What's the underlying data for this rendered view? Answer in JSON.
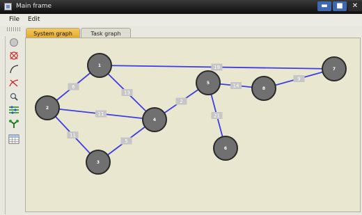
{
  "window": {
    "title": "Main frame",
    "min_label": "▬",
    "max_label": "■",
    "close_label": "✕"
  },
  "menu": {
    "items": [
      "File",
      "Edit"
    ]
  },
  "tabs": [
    {
      "label": "System graph",
      "active": true
    },
    {
      "label": "Task graph",
      "active": false
    }
  ],
  "toolbar": {
    "tools": [
      {
        "name": "add-node-icon"
      },
      {
        "name": "delete-node-icon"
      },
      {
        "name": "add-edge-icon"
      },
      {
        "name": "delete-edge-icon"
      },
      {
        "name": "zoom-icon"
      },
      {
        "name": "layout-icon"
      },
      {
        "name": "tree-icon"
      },
      {
        "name": "table-icon"
      }
    ]
  },
  "graph": {
    "node_color": "#707070",
    "edge_color": "#3c3ce6",
    "nodes": [
      {
        "id": "1",
        "label": "1"
      },
      {
        "id": "2",
        "label": "2"
      },
      {
        "id": "3",
        "label": "3"
      },
      {
        "id": "4",
        "label": "4"
      },
      {
        "id": "5",
        "label": "5"
      },
      {
        "id": "6",
        "label": "6"
      },
      {
        "id": "7",
        "label": "7"
      },
      {
        "id": "8",
        "label": "8"
      }
    ],
    "edges": [
      {
        "from": "1",
        "to": "7",
        "weight": "19"
      },
      {
        "from": "1",
        "to": "2",
        "weight": "6"
      },
      {
        "from": "1",
        "to": "4",
        "weight": "13"
      },
      {
        "from": "2",
        "to": "4",
        "weight": "11"
      },
      {
        "from": "2",
        "to": "3",
        "weight": "11"
      },
      {
        "from": "3",
        "to": "4",
        "weight": "5"
      },
      {
        "from": "4",
        "to": "5",
        "weight": "2"
      },
      {
        "from": "5",
        "to": "8",
        "weight": "14"
      },
      {
        "from": "8",
        "to": "7",
        "weight": "9"
      },
      {
        "from": "5",
        "to": "6",
        "weight": "21"
      }
    ]
  }
}
